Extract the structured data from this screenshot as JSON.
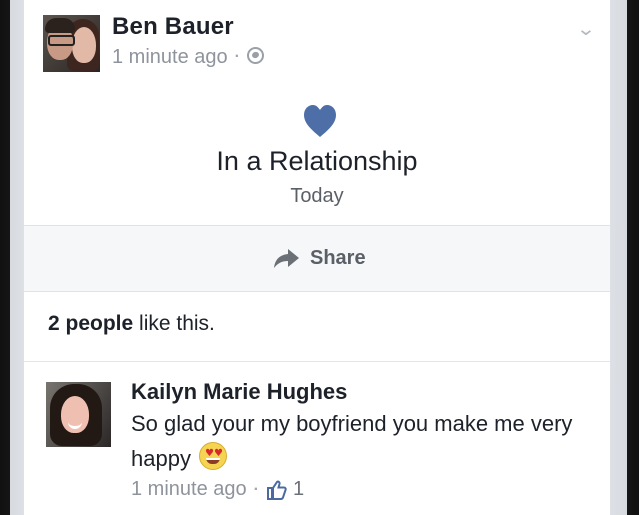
{
  "post": {
    "author": "Ben Bauer",
    "time": "1 minute ago",
    "privacy_icon": "globe-icon",
    "menu_icon": "chevron-down-icon",
    "life_event": {
      "icon": "heart-icon",
      "icon_color": "#4d6ea7",
      "title": "In a Relationship",
      "subtitle": "Today"
    },
    "share_label": "Share",
    "likes": {
      "bold": "2 people",
      "rest": " like this."
    }
  },
  "comment": {
    "author": "Kailyn Marie Hughes",
    "text": "So glad your my boyfriend you make me very happy",
    "emoji": "heart-eyes-emoji",
    "time": "1 minute ago",
    "like_count": "1",
    "like_icon": "thumbs-up-icon"
  },
  "colors": {
    "primary_text": "#1d2129",
    "secondary_text": "#8f949c",
    "share_bar": "#f6f7f9",
    "heart": "#4d6ea7"
  }
}
